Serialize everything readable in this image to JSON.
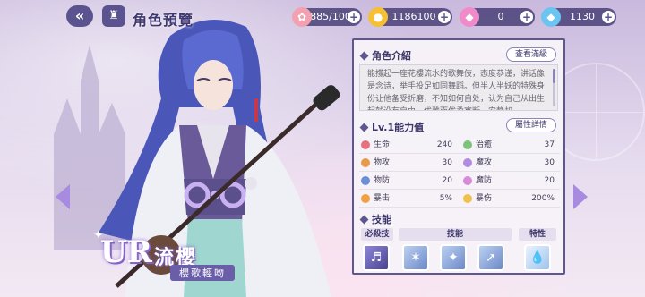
{
  "header": {
    "back_icon": "double-chevron-left",
    "home_icon": "castle-icon",
    "title": "角色預覽",
    "resources": [
      {
        "icon": "candy-icon",
        "value": "885/100"
      },
      {
        "icon": "coin-icon",
        "value": "1186100"
      },
      {
        "icon": "pink-diamond-icon",
        "value": "0"
      },
      {
        "icon": "blue-diamond-icon",
        "value": "1130"
      }
    ]
  },
  "character": {
    "rarity": "UR",
    "name": "流櫻",
    "title": "櫻歌輕吻"
  },
  "panel": {
    "intro_label": "角色介紹",
    "view_full_label": "查看滿級",
    "intro_text": "能撐起一座花樓流水的歌舞伎，态度恭谨，讲话像是念诗，举手投足如同舞蹈。但半人半妖的特殊身份让他备受折磨，不知如何自处，认为自己从出生起就没有自由。优雅而优柔寡断，安静却",
    "ability_label": "Lv.1能力值",
    "attr_detail_label": "屬性詳情",
    "stats": [
      {
        "left": {
          "label": "生命",
          "value": "240",
          "color": "#e8707c"
        },
        "right": {
          "label": "治癒",
          "value": "37",
          "color": "#7cc47a"
        }
      },
      {
        "left": {
          "label": "物攻",
          "value": "30",
          "color": "#e89a4a"
        },
        "right": {
          "label": "魔攻",
          "value": "30",
          "color": "#b08ce0"
        }
      },
      {
        "left": {
          "label": "物防",
          "value": "20",
          "color": "#6b8fd8"
        },
        "right": {
          "label": "魔防",
          "value": "20",
          "color": "#d88ad8"
        }
      },
      {
        "left": {
          "label": "暴击",
          "value": "5%",
          "color": "#f0a040"
        },
        "right": {
          "label": "暴伤",
          "value": "200%",
          "color": "#f0c04a"
        }
      }
    ],
    "skills_label": "技能",
    "skill_tabs": [
      "必殺技",
      "技能",
      "特性"
    ],
    "skills": [
      "lyre-icon",
      "star-burst-icon",
      "all-icon",
      "blade-icon",
      "drop-icon"
    ]
  }
}
